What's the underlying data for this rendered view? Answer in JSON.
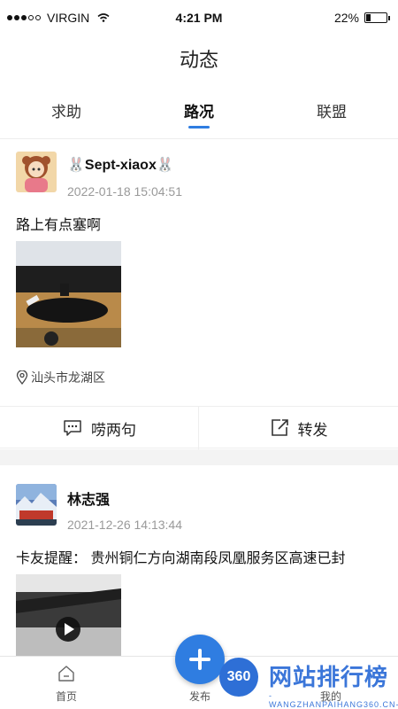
{
  "status_bar": {
    "carrier": "VIRGIN",
    "time": "4:21 PM",
    "battery": "22%",
    "battery_level": 0.22
  },
  "header": {
    "title": "动态"
  },
  "tabs": [
    {
      "label": "求助"
    },
    {
      "label": "路况",
      "active": true
    },
    {
      "label": "联盟"
    }
  ],
  "posts": [
    {
      "username": "🐰Sept-xiaox🐰",
      "time": "2022-01-18 15:04:51",
      "text": "路上有点塞啊",
      "location": "汕头市龙湖区"
    },
    {
      "username": "林志强",
      "time": "2021-12-26 14:13:44",
      "text": "卡友提醒：  贵州铜仁方向湖南段凤凰服务区高速已封"
    }
  ],
  "actions": {
    "comment_label": "唠两句",
    "share_label": "转发"
  },
  "bottom_nav": {
    "home_label": "首页",
    "publish_label": "发布",
    "mine_label": "我的"
  },
  "watermark": {
    "badge": "360",
    "title": "网站排行榜",
    "subtitle": "-WANGZHANPAIHANG360.CN-"
  },
  "colors": {
    "accent": "#2f7de1"
  }
}
